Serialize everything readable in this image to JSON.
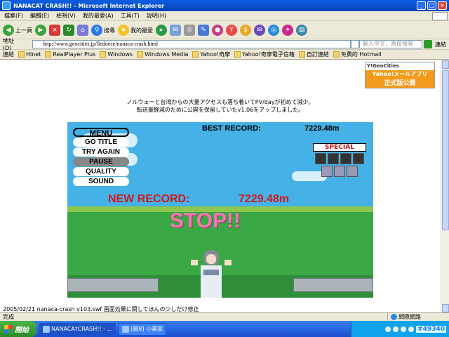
{
  "window": {
    "title": "NANACAT CRASH!! - Microsoft Internet Explorer"
  },
  "menu": [
    "檔案(F)",
    "編輯(E)",
    "檢視(V)",
    "我的最愛(A)",
    "工具(T)",
    "說明(H)"
  ],
  "toolbar": {
    "back": "上一頁",
    "search": "搜尋",
    "favorites": "我的最愛"
  },
  "address": {
    "label": "地址(D)",
    "url": "http://www.geocities.jp/lledoece/nanaca-crash.html",
    "search_placeholder": "輸入中文，直接搜尋",
    "links_label": "連結"
  },
  "links_label": "連結",
  "links": [
    "Hinet",
    "RealPlayer Plus",
    "Windows",
    "Windows Media",
    "Yahoo!奇摩",
    "Yahoo!奇摩電子信箱",
    "自訂連結",
    "免費的 Hotmail"
  ],
  "geocities": {
    "brand": "Y!GeoCities",
    "line1": "Yahoo!メールアプリ",
    "line2": "正式版公開"
  },
  "notice": {
    "line1": "ノルウェーと台湾からの大量アクセスも落ち着いてPV/dayが初めて減少。",
    "line2": "転送量軽減のために公開を保留していたv1.06をアップしました。"
  },
  "game": {
    "menu_items": [
      "MENU",
      "GO TITLE",
      "TRY AGAIN",
      "PAUSE",
      "QUALITY",
      "SOUND"
    ],
    "best_label": "BEST RECORD:",
    "best_value": "7229.48m",
    "new_label": "NEW RECORD:",
    "new_value": "7229.48m",
    "stop": "STOP!!",
    "special": "SPECIAL"
  },
  "footer_text": "2005/02/21 nanaca-crash v103.swf 画面効果に関してほんの少しだけ修正",
  "status": {
    "left": "完成",
    "zone": "網際網路"
  },
  "taskbar": {
    "start": "開始",
    "task1": "NANACA†CRASH!! - ...",
    "task2": "[圖8] 小畫家",
    "clock": "#49340"
  }
}
